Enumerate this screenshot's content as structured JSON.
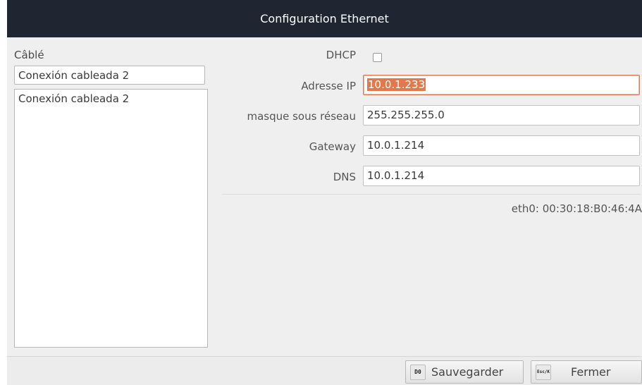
{
  "window": {
    "title": "Configuration Ethernet"
  },
  "connections": {
    "section_label": "Câblé",
    "name_value": "Conexión cableada 2",
    "items": [
      "Conexión cableada 2"
    ]
  },
  "form": {
    "dhcp_label": "DHCP",
    "dhcp_checked": false,
    "ip_label": "Adresse IP",
    "ip_value": "10.0.1.233",
    "mask_label": "masque sous réseau",
    "mask_value": "255.255.255.0",
    "gateway_label": "Gateway",
    "gateway_value": "10.0.1.214",
    "dns_label": "DNS",
    "dns_value": "10.0.1.214",
    "mac_text": "eth0: 00:30:18:B0:46:4A"
  },
  "footer": {
    "save_key": "D0",
    "save_label": "Sauvegarder",
    "close_key": "Esc/K",
    "close_label": "Fermer"
  },
  "colors": {
    "titlebar": "#1f2631",
    "accent": "#e07a4e"
  }
}
